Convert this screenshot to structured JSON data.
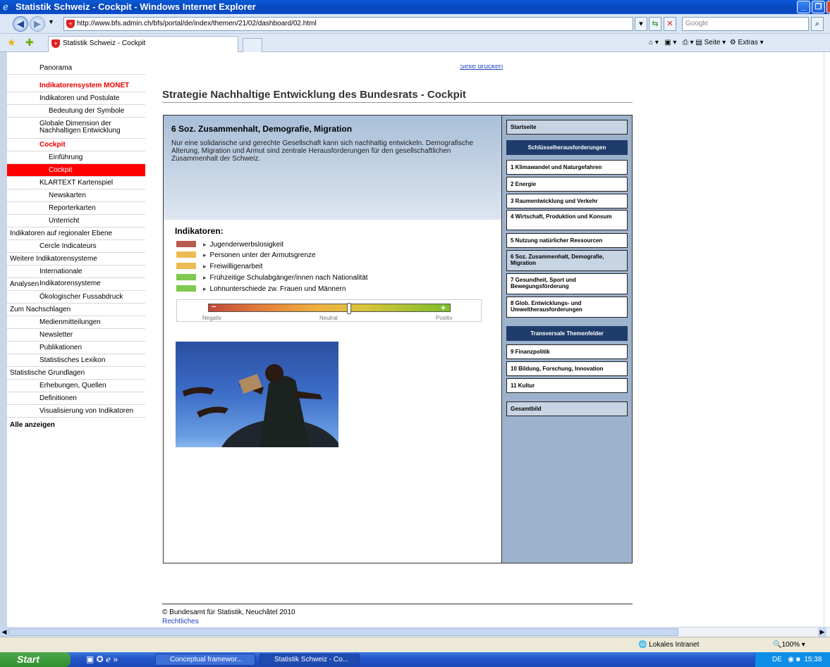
{
  "window": {
    "title": "Statistik Schweiz - Cockpit - Windows Internet Explorer"
  },
  "addressbar": {
    "url": "http://www.bfs.admin.ch/bfs/portal/de/index/themen/21/02/dashboard/02.html",
    "search_placeholder": "Google"
  },
  "tabs": {
    "active": "Statistik Schweiz - Cockpit"
  },
  "toolbar": {
    "seite": "Seite",
    "extras": "Extras"
  },
  "sidebar": {
    "items": [
      {
        "label": "Panorama"
      },
      {
        "label": "Indikatorensystem MONET"
      },
      {
        "label": "Indikatoren und Postulate"
      },
      {
        "label": "Bedeutung der Symbole"
      },
      {
        "label": "Globale Dimension der Nachhaltigen Entwicklung"
      },
      {
        "label": "Cockpit"
      },
      {
        "label": "Einführung"
      },
      {
        "label": "Cockpit"
      },
      {
        "label": "KLARTEXT Kartenspiel"
      },
      {
        "label": "Newskarten"
      },
      {
        "label": "Reporterkarten"
      },
      {
        "label": "Unterricht"
      },
      {
        "label": "Indikatoren auf regionaler Ebene"
      },
      {
        "label": "Cercle Indicateurs"
      },
      {
        "label": "Weitere Indikatorensysteme"
      },
      {
        "label": "Internationale Indikatorensysteme"
      },
      {
        "label": "Analysen"
      },
      {
        "label": "Ökologischer Fussabdruck"
      },
      {
        "label": "Zum Nachschlagen"
      },
      {
        "label": "Medienmitteilungen"
      },
      {
        "label": "Newsletter"
      },
      {
        "label": "Publikationen"
      },
      {
        "label": "Statistisches Lexikon"
      },
      {
        "label": "Statistische Grundlagen"
      },
      {
        "label": "Erhebungen, Quellen"
      },
      {
        "label": "Definitionen"
      },
      {
        "label": "Visualisierung von Indikatoren"
      },
      {
        "label": "Alle anzeigen"
      }
    ]
  },
  "main": {
    "print_link": "Seite drucken",
    "heading": "Strategie Nachhaltige Entwicklung des Bundesrats - Cockpit",
    "section_title": "6 Soz. Zusammenhalt, Demografie, Migration",
    "section_desc": "Nur eine solidarische und gerechte Gesellschaft kann sich nachhaltig entwickeln. Demografische Alterung, Migration und Armut sind zentrale Herausforderungen für den gesellschaftlichen Zusammenhalt der Schweiz.",
    "indicators_title": "Indikatoren:",
    "indicators": [
      {
        "label": "Jugenderwerbslosigkeit",
        "color": "#b85a4e"
      },
      {
        "label": "Personen unter der Armutsgrenze",
        "color": "#ecbc52"
      },
      {
        "label": "Freiwilligenarbeit",
        "color": "#ecbc52"
      },
      {
        "label": "Frühzeitige Schulabgänger/innen nach Nationalität",
        "color": "#7fc94f"
      },
      {
        "label": "Lohnunterschiede zw. Frauen und Männern",
        "color": "#7fc94f"
      }
    ],
    "scale": {
      "minus": "−",
      "plus": "+",
      "negative": "Negativ",
      "neutral": "Neutral",
      "positive": "Positiv"
    }
  },
  "rightnav": {
    "start": "Startseite",
    "key_header": "Schlüsselherausforderungen",
    "items": [
      "1 Klimawandel und Naturgefahren",
      "2 Energie",
      "3 Raumentwicklung und Verkehr",
      "4 Wirtschaft, Produktion und Konsum",
      "5 Nutzung natürlicher Ressourcen",
      "6 Soz. Zusammenhalt, Demografie, Migration",
      "7 Gesundheit, Sport und Bewegungsförderung",
      "8 Glob. Entwicklungs- und Umweltherausforderungen"
    ],
    "trans_header": "Transversale Themenfelder",
    "trans_items": [
      "9 Finanzpolitik",
      "10 Bildung, Forschung, Innovation",
      "11 Kultur"
    ],
    "overall": "Gesamtbild"
  },
  "footer": {
    "copyright": "© Bundesamt für Statistik, Neuchâtel 2010",
    "legal": "Rechtliches"
  },
  "statusbar": {
    "zone": "Lokales Intranet",
    "zoom": "100%"
  },
  "taskbar": {
    "start": "Start",
    "task1": "Conceptual framewor...",
    "task2": "Statistik Schweiz - Co...",
    "lang": "DE",
    "time": "15:38"
  }
}
